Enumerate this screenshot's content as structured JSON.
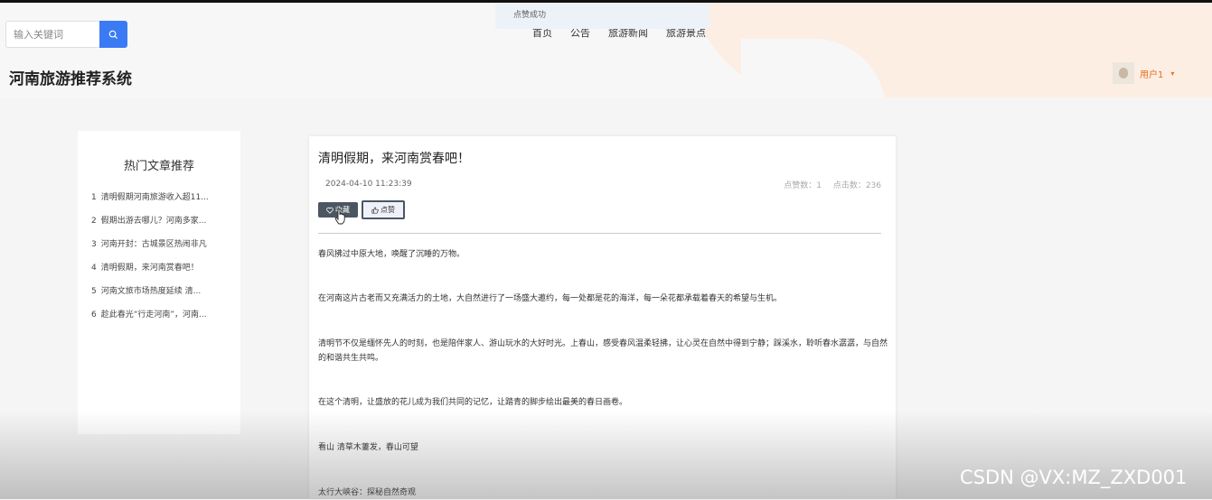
{
  "search": {
    "placeholder": "输入关键词"
  },
  "toast": {
    "message": "点赞成功"
  },
  "nav": {
    "items": [
      "首页",
      "公告",
      "旅游新闻",
      "旅游景点"
    ]
  },
  "brand": {
    "title": "河南旅游推荐系统"
  },
  "user": {
    "name": "用户1",
    "caret": "▾"
  },
  "sidebar": {
    "title": "热门文章推荐",
    "items": [
      {
        "no": "1",
        "text": "清明假期河南旅游收入超11..."
      },
      {
        "no": "2",
        "text": "假期出游去哪儿？河南多家..."
      },
      {
        "no": "3",
        "text": "河南开封：古城景区热闹非凡"
      },
      {
        "no": "4",
        "text": "清明假期，来河南赏春吧！"
      },
      {
        "no": "5",
        "text": "河南文旅市场热度延续 清..."
      },
      {
        "no": "6",
        "text": "趁此春光“行走河南”，河南..."
      }
    ]
  },
  "article": {
    "title": "清明假期，来河南赏春吧！",
    "date": "2024-04-10 11:23:39",
    "likes_label": "点赞数：1",
    "clicks_label": "点击数：236",
    "fav_button": "收藏",
    "like_button": "点赞",
    "paragraphs": [
      "春风拂过中原大地，唤醒了沉睡的万物。",
      "在河南这片古老而又充满活力的土地，大自然进行了一场盛大邀约，每一处都是花的海洋，每一朵花都承载着春天的希望与生机。",
      "清明节不仅是缅怀先人的时刻，也是陪伴家人、游山玩水的大好时光。上春山，感受春风温柔轻拂，让心灵在自然中得到宁静；踩溪水，聆听春水潺潺，与自然的和谐共生共鸣。",
      "在这个清明，让盛放的花儿成为我们共同的记忆，让踏青的脚步绘出最美的春日画卷。",
      "看山 清草木萋发，春山可望",
      "太行大峡谷：探秘自然奇观"
    ]
  },
  "watermark": "CSDN @VX:MZ_ZXD001"
}
